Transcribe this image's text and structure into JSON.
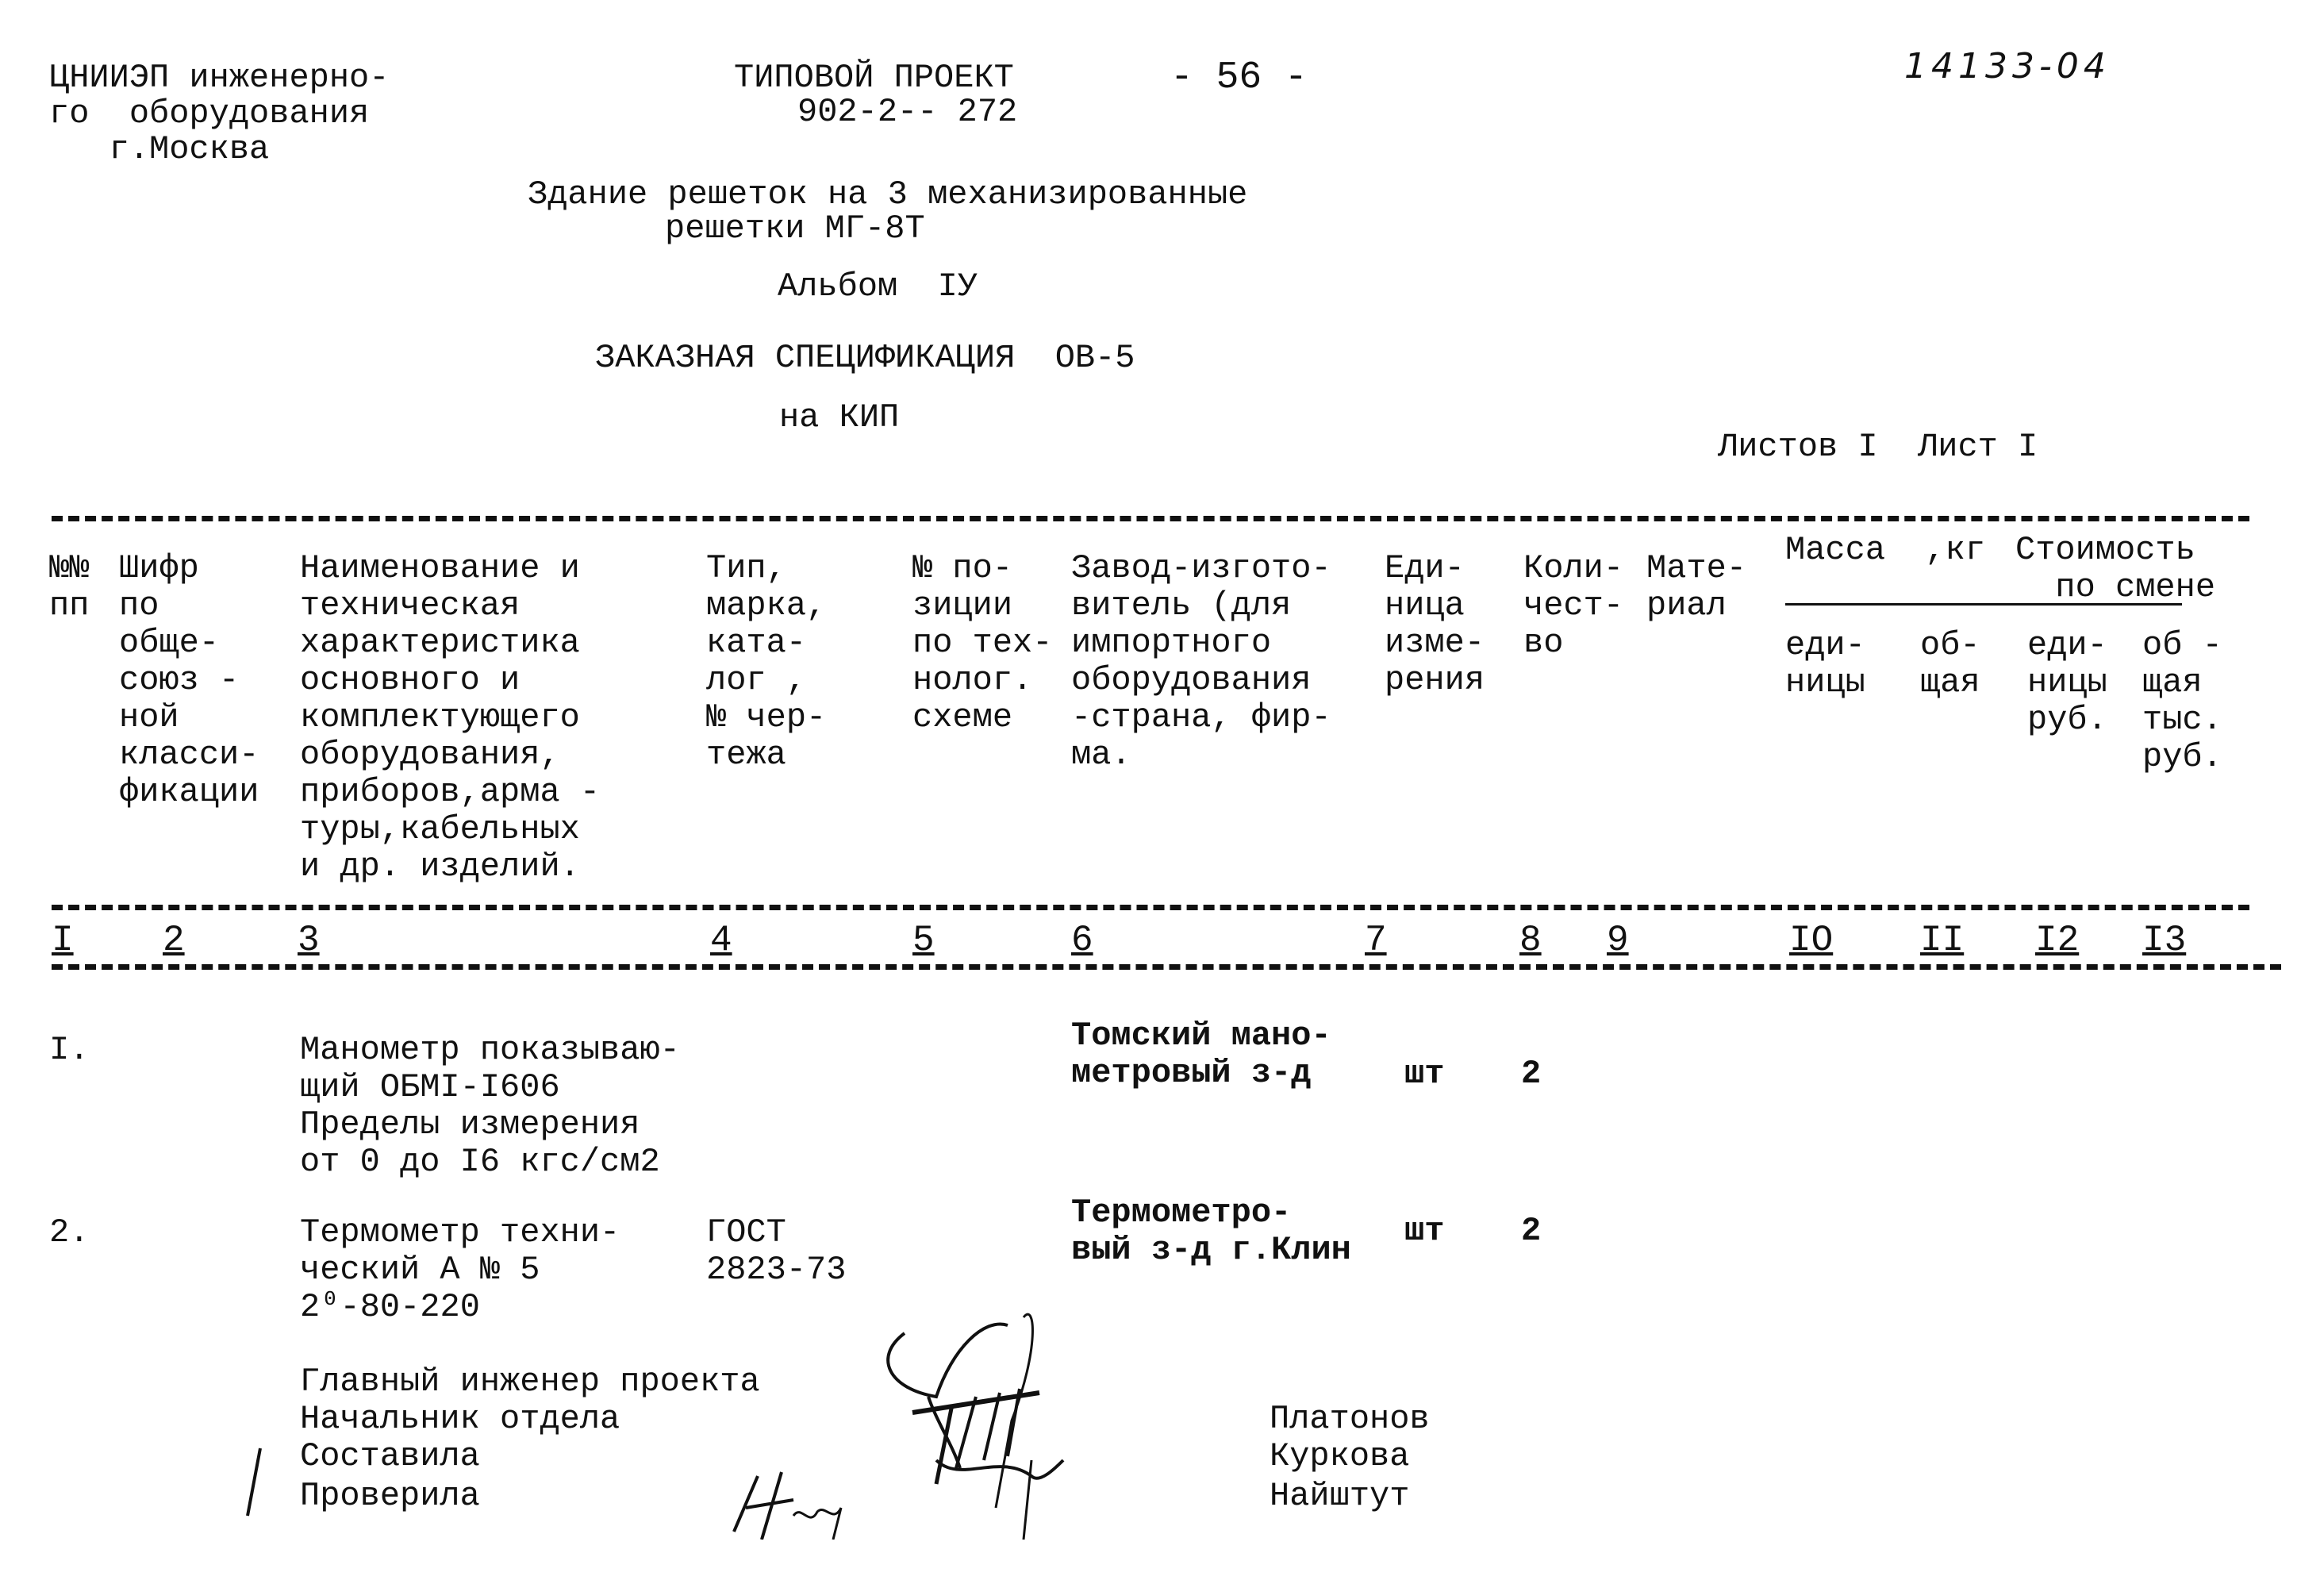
{
  "header": {
    "org_lines": [
      "ЦНИИЭП инженерно-",
      "го  оборудования",
      "   г.Москва"
    ],
    "project_label": "ТИПОВОЙ ПРОЕКТ",
    "project_number": "902-2-- 272",
    "page_number": "- 56 -",
    "archive_number": "14133-04",
    "subtitle_lines": [
      "Здание решеток на 3 механизированные",
      "решетки МГ-8Т"
    ],
    "album": "Альбом  IУ",
    "spec_title": "ЗАКАЗНАЯ СПЕЦИФИКАЦИЯ  ОВ-5",
    "spec_subtitle": "на КИП",
    "sheets": "Листов I  Лист I"
  },
  "table": {
    "columns": [
      {
        "num": "I",
        "header": "№№\nпп"
      },
      {
        "num": "2",
        "header": "Шифр\nпо\nобще-\nсоюз -\nной\nкласси-\nфикации"
      },
      {
        "num": "3",
        "header": "Наименование и\nтехническая\nхарактеристика\nосновного и\nкомплектующего\nоборудования,\nприборов,арма -\nтуры,кабельных\nи др. изделий."
      },
      {
        "num": "4",
        "header": "Тип,\nмарка,\nката-\nлог ,\n№ чер-\nтежа"
      },
      {
        "num": "5",
        "header": "№ по-\nзиции\nпо тех-\nнолог.\nсхеме"
      },
      {
        "num": "6",
        "header": "Завод-изгото-\nвитель (для\nимпортного\nоборудования\n-страна, фир-\nма."
      },
      {
        "num": "7",
        "header": "Еди-\nница\nизме-\nрения"
      },
      {
        "num": "8",
        "header": "Коли-\nчест-\nво"
      },
      {
        "num": "9",
        "header": "Мате-\nриал"
      },
      {
        "num": "IO",
        "header": "еди-\nницы"
      },
      {
        "num": "II",
        "header": "об-\nщая"
      },
      {
        "num": "I2",
        "header": "еди-\nницы\nруб."
      },
      {
        "num": "I3",
        "header": "об -\nщая\nтыс.\nруб."
      }
    ],
    "group_headers": {
      "mass": "Масса  ,кг",
      "cost": "Стоимость\n  по смене"
    },
    "rows": [
      {
        "no": "I.",
        "name": "Манометр показываю-\nщий ОБМI-I606\nПределы измерения\nот 0 до I6 кгс/см2",
        "type": "",
        "maker": "Томский мано-\nметровый з-д",
        "unit": "шт",
        "qty": "2"
      },
      {
        "no": "2.",
        "name": "Термометр техни-\nческий А № 5\n2⁰-80-220",
        "type": "ГОСТ\n2823-73",
        "maker": "Термометро-\nвый з-д г.Клин",
        "unit": "шт",
        "qty": "2"
      }
    ]
  },
  "signatures": {
    "roles": [
      "Главный инженер проекта",
      "Начальник отдела",
      "Составила",
      "Проверила"
    ],
    "names": [
      "Платонов",
      "Куркова",
      "Найштут"
    ]
  }
}
